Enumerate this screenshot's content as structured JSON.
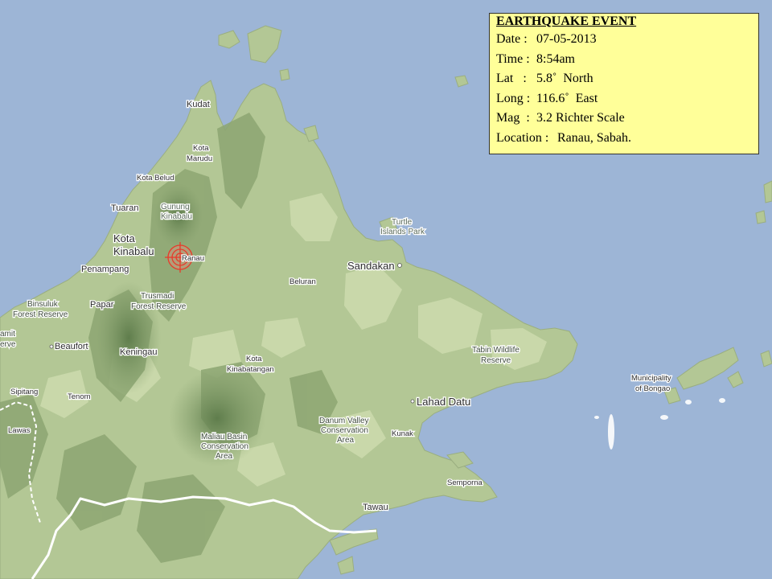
{
  "info_box": {
    "title": "EARTHQUAKE EVENT",
    "date_label": "Date :",
    "date": "07-05-2013",
    "time_label": "Time :",
    "time": "8:54am",
    "lat_label": "Lat   :",
    "lat": "5.8˚  North",
    "long_label": "Long :",
    "long": "116.6˚  East",
    "mag_label": "Mag  :",
    "mag": "3.2 Richter Scale",
    "location_label": "Location :",
    "location": "Ranau, Sabah."
  },
  "map": {
    "colors": {
      "sea": "#9db5d6",
      "land": "#b9cc9a",
      "forest": "#8ea874",
      "highland": "#6f8c5c",
      "border": "#ffffff",
      "epicenter": "#e83a2a",
      "info_box_bg": "#ffff99"
    },
    "epicenter_icon": "target-crosshair-icon",
    "places": {
      "kudat": "Kudat",
      "kota_marudu_1": "Kota",
      "kota_marudu_2": "Marudu",
      "kota_belud": "Kota Belud",
      "tuaran": "Tuaran",
      "gunung_1": "Gunung",
      "gunung_2": "Kinabalu",
      "kota_kinabalu_1": "Kota",
      "kota_kinabalu_2": "Kinabalu",
      "ranau": "Ranau",
      "penampang": "Penampang",
      "papar": "Papar",
      "trusmadi_1": "Trusmadi",
      "trusmadi_2": "Forest Reserve",
      "binsuluk_1": "Binsuluk",
      "binsuluk_2": "Forest Reserve",
      "amit_1": "amit",
      "amit_2": "erve",
      "beaufort": "Beaufort",
      "keningau": "Keningau",
      "sipitang": "Sipitang",
      "tenom": "Tenom",
      "lawas": "Lawas",
      "kota_kinabatangan_1": "Kota",
      "kota_kinabatangan_2": "Kinabatangan",
      "beluran": "Beluran",
      "sandakan": "Sandakan",
      "turtle_1": "Turtle",
      "turtle_2": "Islands Park",
      "tabin_1": "Tabin Wildlife",
      "tabin_2": "Reserve",
      "lahad_datu": "Lahad Datu",
      "danum_1": "Danum Valley",
      "danum_2": "Conservation",
      "danum_3": "Area",
      "maliau_1": "Maliau Basin",
      "maliau_2": "Conservation",
      "maliau_3": "Area",
      "kunak": "Kunak",
      "semporna": "Semporna",
      "tawau": "Tawau",
      "bongao_1": "Municipality",
      "bongao_2": "of Bongao"
    }
  }
}
